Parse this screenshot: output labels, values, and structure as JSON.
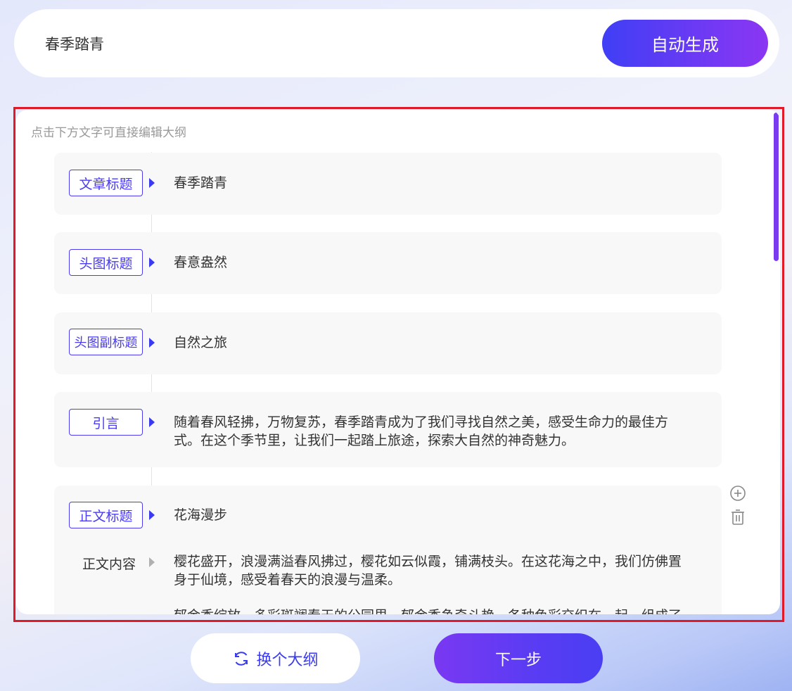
{
  "topic": {
    "value": "春季踏青"
  },
  "auto_generate_label": "自动生成",
  "outline": {
    "hint": "点击下方文字可直接编辑大纲",
    "article_title": {
      "tag": "文章标题",
      "value": "春季踏青"
    },
    "header_title": {
      "tag": "头图标题",
      "value": "春意盎然"
    },
    "header_subtitle": {
      "tag": "头图副标题",
      "value": "自然之旅"
    },
    "intro": {
      "tag": "引言",
      "line1": "随着春风轻拂，万物复苏，春季踏青成为了我们寻找自然之美，感受生命力的最佳方",
      "line2": "式。在这个季节里，让我们一起踏上旅途，探索大自然的神奇魅力。"
    },
    "section": {
      "title_tag": "正文标题",
      "title_value": "花海漫步",
      "content_label": "正文内容",
      "para1_line1": "樱花盛开，浪漫满溢春风拂过，樱花如云似霞，铺满枝头。在这花海之中，我们仿佛置",
      "para1_line2": "身于仙境，感受着春天的浪漫与温柔。",
      "para2_partial": "郁金香绽放，多彩斑斓春天的公园里，郁金香争奇斗艳，各种色彩交织在一起，组成了"
    }
  },
  "buttons": {
    "change_outline": "换个大纲",
    "next_step": "下一步"
  },
  "colors": {
    "accent": "#3a3af2",
    "gradient_end": "#8b36f3",
    "highlight_frame": "#e11a2a"
  }
}
